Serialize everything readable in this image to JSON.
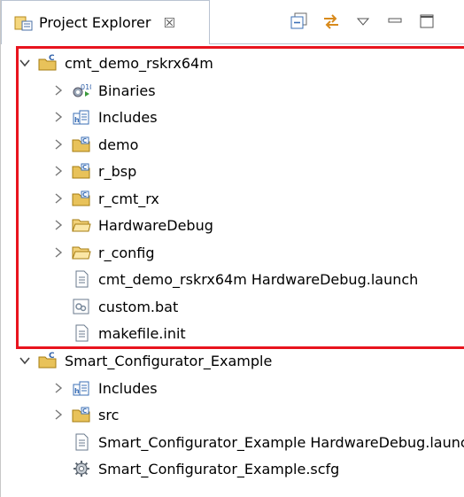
{
  "view": {
    "tab_label": "Project Explorer",
    "tab_close_symbol": "☒",
    "toolbar": [
      "collapse-all-icon",
      "link-with-editor-icon",
      "view-menu-icon",
      "minimize-icon",
      "maximize-icon"
    ]
  },
  "tree": {
    "project1": {
      "name": "cmt_demo_rskrx64m",
      "items": [
        {
          "label": "Binaries"
        },
        {
          "label": "Includes"
        },
        {
          "label": "demo"
        },
        {
          "label": "r_bsp"
        },
        {
          "label": "r_cmt_rx"
        },
        {
          "label": "HardwareDebug"
        },
        {
          "label": "r_config"
        },
        {
          "label": "cmt_demo_rskrx64m HardwareDebug.launch"
        },
        {
          "label": "custom.bat"
        },
        {
          "label": "makefile.init"
        }
      ]
    },
    "project2": {
      "name": "Smart_Configurator_Example",
      "items": [
        {
          "label": "Includes"
        },
        {
          "label": "src"
        },
        {
          "label": "Smart_Configurator_Example HardwareDebug.launch"
        },
        {
          "label": "Smart_Configurator_Example.scfg"
        }
      ]
    }
  },
  "colors": {
    "highlight": "#e8141e",
    "folder": "#e8c25a",
    "tab_border": "#b9c3d1"
  }
}
